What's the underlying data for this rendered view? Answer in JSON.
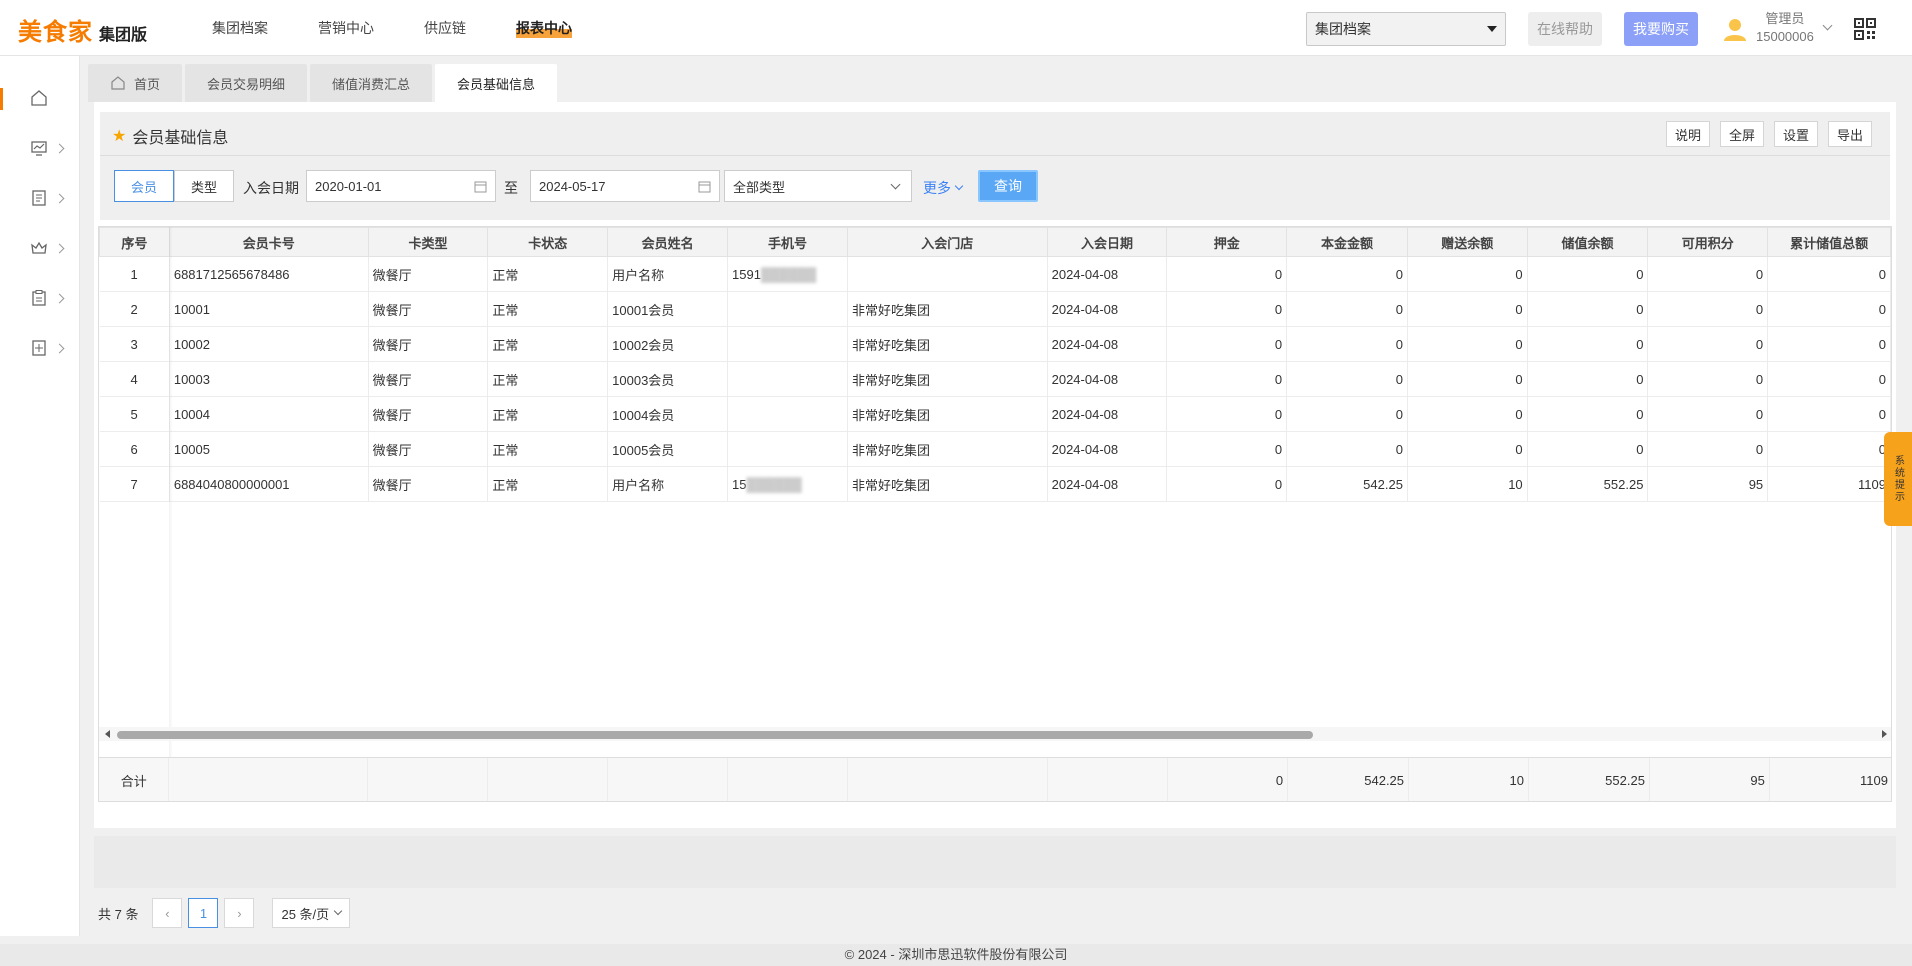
{
  "header": {
    "logo_main": "美食家",
    "logo_sub": "集团版",
    "nav": [
      "集团档案",
      "营销中心",
      "供应链",
      "报表中心"
    ],
    "archive_select": "集团档案",
    "help": "在线帮助",
    "buy": "我要购买",
    "user_role": "管理员",
    "user_id": "15000006"
  },
  "tabs": [
    "首页",
    "会员交易明细",
    "储值消费汇总",
    "会员基础信息"
  ],
  "panel": {
    "title": "会员基础信息",
    "buttons": [
      "说明",
      "全屏",
      "设置",
      "导出"
    ]
  },
  "filter": {
    "seg": [
      "会员",
      "类型"
    ],
    "date_label": "入会日期",
    "date_from": "2020-01-01",
    "to": "至",
    "date_to": "2024-05-17",
    "type": "全部类型",
    "more": "更多",
    "query": "查询"
  },
  "table": {
    "headers": [
      "序号",
      "会员卡号",
      "卡类型",
      "卡状态",
      "会员姓名",
      "手机号",
      "入会门店",
      "入会日期",
      "押金",
      "本金金额",
      "赠送余额",
      "储值余额",
      "可用积分",
      "累计储值总额"
    ],
    "rows": [
      [
        "1",
        "6881712565678486",
        "微餐厅",
        "正常",
        "用户名称",
        "1591",
        "",
        "2024-04-08",
        "0",
        "0",
        "0",
        "0",
        "0",
        "0"
      ],
      [
        "2",
        "10001",
        "微餐厅",
        "正常",
        "10001会员",
        "",
        "非常好吃集团",
        "2024-04-08",
        "0",
        "0",
        "0",
        "0",
        "0",
        "0"
      ],
      [
        "3",
        "10002",
        "微餐厅",
        "正常",
        "10002会员",
        "",
        "非常好吃集团",
        "2024-04-08",
        "0",
        "0",
        "0",
        "0",
        "0",
        "0"
      ],
      [
        "4",
        "10003",
        "微餐厅",
        "正常",
        "10003会员",
        "",
        "非常好吃集团",
        "2024-04-08",
        "0",
        "0",
        "0",
        "0",
        "0",
        "0"
      ],
      [
        "5",
        "10004",
        "微餐厅",
        "正常",
        "10004会员",
        "",
        "非常好吃集团",
        "2024-04-08",
        "0",
        "0",
        "0",
        "0",
        "0",
        "0"
      ],
      [
        "6",
        "10005",
        "微餐厅",
        "正常",
        "10005会员",
        "",
        "非常好吃集团",
        "2024-04-08",
        "0",
        "0",
        "0",
        "0",
        "0",
        "0"
      ],
      [
        "7",
        "6884040800000001",
        "微餐厅",
        "正常",
        "用户名称",
        "15",
        "非常好吃集团",
        "2024-04-08",
        "0",
        "542.25",
        "10",
        "552.25",
        "95",
        "1109"
      ]
    ],
    "total_label": "合计",
    "totals": [
      "0",
      "542.25",
      "10",
      "552.25",
      "95",
      "1109"
    ]
  },
  "pager": {
    "total": "共 7 条",
    "page": "1",
    "size": "25 条/页"
  },
  "footer": "© 2024 - 深圳市思迅软件股份有限公司",
  "sys_tip": "系统提示"
}
